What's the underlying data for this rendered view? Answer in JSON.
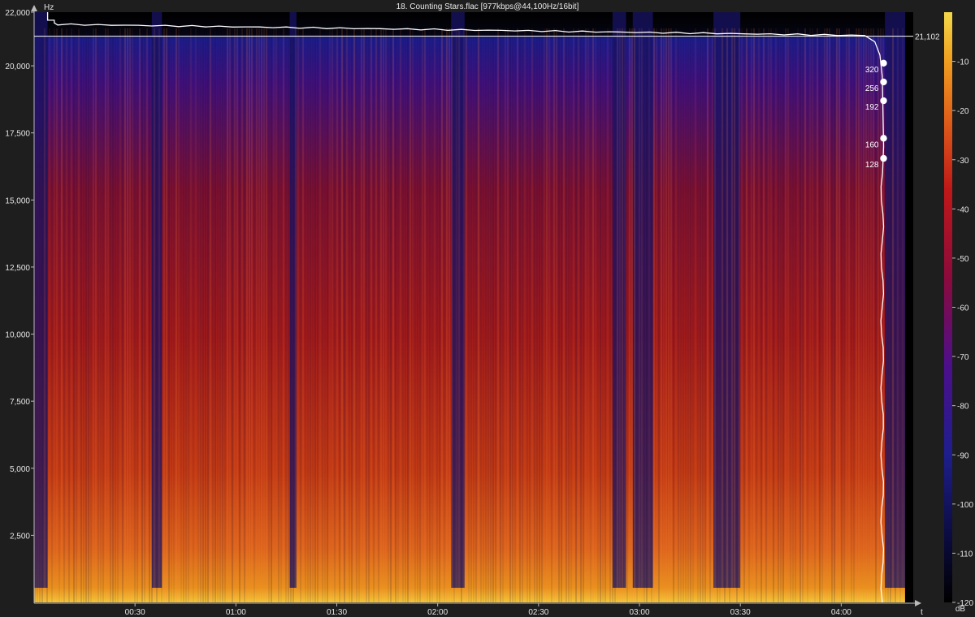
{
  "window": {
    "title": "18. Counting Stars.flac [977kbps@44,100Hz/16bit]"
  },
  "chart_data": {
    "type": "heatmap",
    "title": "18. Counting Stars.flac [977kbps@44,100Hz/16bit]",
    "ylabel": "Hz",
    "xlabel": "t",
    "colorbar_label": "dB",
    "ylim": [
      0,
      22000
    ],
    "xlim_seconds": [
      0,
      259
    ],
    "y_ticks": [
      {
        "value": 22000,
        "label": "22,000"
      },
      {
        "value": 20000,
        "label": "20,000"
      },
      {
        "value": 17500,
        "label": "17,500"
      },
      {
        "value": 15000,
        "label": "15,000"
      },
      {
        "value": 12500,
        "label": "12,500"
      },
      {
        "value": 10000,
        "label": "10,000"
      },
      {
        "value": 7500,
        "label": "7,500"
      },
      {
        "value": 5000,
        "label": "5,000"
      },
      {
        "value": 2500,
        "label": "2,500"
      }
    ],
    "x_ticks": [
      {
        "value": 30,
        "label": "00:30"
      },
      {
        "value": 60,
        "label": "01:00"
      },
      {
        "value": 90,
        "label": "01:30"
      },
      {
        "value": 120,
        "label": "02:00"
      },
      {
        "value": 150,
        "label": "02:30"
      },
      {
        "value": 180,
        "label": "03:00"
      },
      {
        "value": 210,
        "label": "03:30"
      },
      {
        "value": 240,
        "label": "04:00"
      }
    ],
    "colorbar_ticks": [
      {
        "value": -10,
        "label": "-10"
      },
      {
        "value": -20,
        "label": "-20"
      },
      {
        "value": -30,
        "label": "-30"
      },
      {
        "value": -40,
        "label": "-40"
      },
      {
        "value": -50,
        "label": "-50"
      },
      {
        "value": -60,
        "label": "-60"
      },
      {
        "value": -70,
        "label": "-70"
      },
      {
        "value": -80,
        "label": "-80"
      },
      {
        "value": -90,
        "label": "-90"
      },
      {
        "value": -100,
        "label": "-100"
      },
      {
        "value": -110,
        "label": "-110"
      },
      {
        "value": -120,
        "label": "-120"
      }
    ],
    "colorbar_range": [
      -120,
      0
    ],
    "colormap": [
      "#000000",
      "#0a0a3a",
      "#1e1e8c",
      "#4c0f8c",
      "#8c0a3c",
      "#c01818",
      "#e0601a",
      "#f0a020",
      "#f2d84a"
    ],
    "cutoff": {
      "value": 21102,
      "label": "21,102"
    },
    "bitrate_markers": [
      {
        "label": "320",
        "freq": 20100
      },
      {
        "label": "256",
        "freq": 19400
      },
      {
        "label": "192",
        "freq": 18700
      },
      {
        "label": "160",
        "freq": 17300
      },
      {
        "label": "128",
        "freq": 16550
      }
    ],
    "quiet_segments_seconds": [
      [
        0,
        4
      ],
      [
        35,
        38
      ],
      [
        76,
        78
      ],
      [
        124,
        128
      ],
      [
        172,
        176
      ],
      [
        178,
        184
      ],
      [
        202,
        210
      ],
      [
        253,
        259
      ]
    ],
    "line_color": "#ffffff",
    "axis_color": "#bbbbbb",
    "background": "#1e1e1e"
  }
}
